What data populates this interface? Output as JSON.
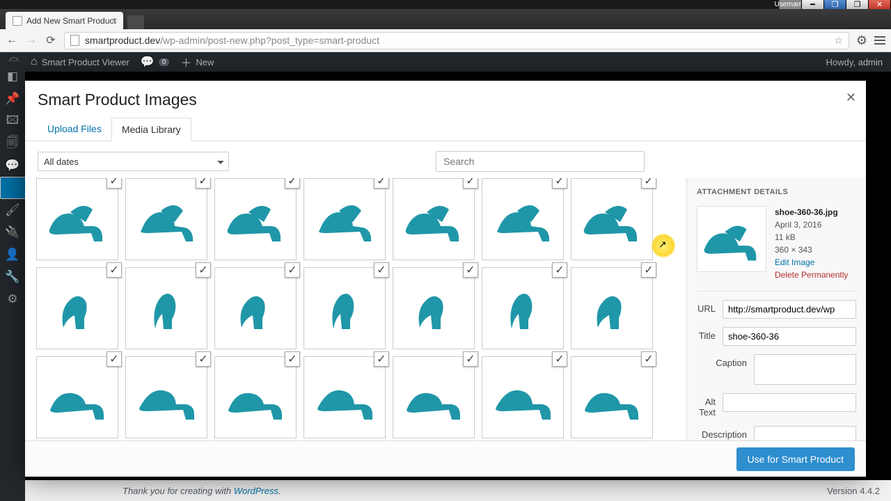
{
  "os": {
    "username": "Username"
  },
  "browser": {
    "tab_title": "Add New Smart Product",
    "url_host": "smartproduct.dev",
    "url_path": "/wp-admin/post-new.php?post_type=smart-product"
  },
  "wpbar": {
    "site": "Smart Product Viewer",
    "comments": "0",
    "new": "New",
    "howdy": "Howdy, admin"
  },
  "footer": {
    "thanks_prefix": "Thank you for creating with ",
    "thanks_link": "WordPress",
    "version": "Version 4.4.2"
  },
  "modal": {
    "title": "Smart Product Images",
    "tabs": {
      "upload": "Upload Files",
      "library": "Media Library"
    },
    "filter": {
      "dates": "All dates",
      "search_ph": "Search"
    },
    "submit": "Use for Smart Product"
  },
  "details": {
    "heading": "ATTACHMENT DETAILS",
    "filename": "shoe-360-36.jpg",
    "date": "April 3, 2016",
    "size": "11 kB",
    "dims": "360 × 343",
    "edit": "Edit Image",
    "del": "Delete Permanently",
    "labels": {
      "url": "URL",
      "title": "Title",
      "caption": "Caption",
      "alt": "Alt Text",
      "desc": "Description"
    },
    "values": {
      "url": "http://smartproduct.dev/wp",
      "title": "shoe-360-36",
      "caption": "",
      "alt": "",
      "desc": ""
    }
  }
}
